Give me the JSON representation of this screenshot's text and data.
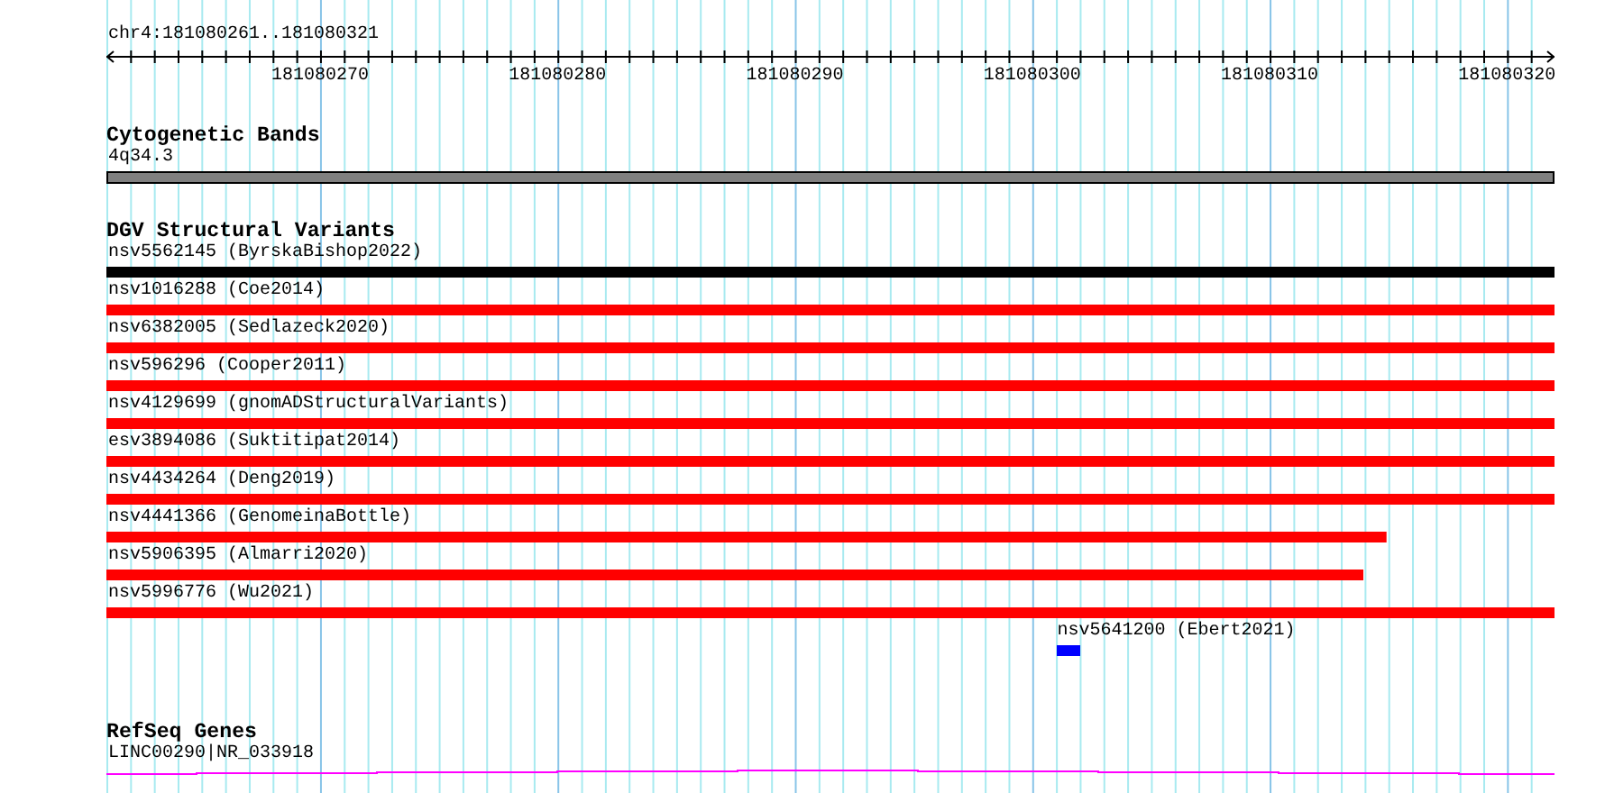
{
  "ruler": {
    "location": "chr4:181080261..181080321",
    "ticks": [
      "181080270",
      "181080280",
      "181080290",
      "181080300",
      "181080310",
      "181080320"
    ]
  },
  "cytogenetic_bands": {
    "title": "Cytogenetic Bands",
    "band": "4q34.3"
  },
  "dgv_structural_variants": {
    "title": "DGV Structural Variants",
    "variants": [
      {
        "label": "nsv5562145 (ByrskaBishop2022)",
        "kind": "full",
        "color": "#000000"
      },
      {
        "label": "nsv1016288 (Coe2014)",
        "kind": "full",
        "color": "#ff0000"
      },
      {
        "label": "nsv6382005 (Sedlazeck2020)",
        "kind": "full",
        "color": "#ff0000"
      },
      {
        "label": "nsv596296 (Cooper2011)",
        "kind": "full",
        "color": "#ff0000"
      },
      {
        "label": "nsv4129699 (gnomADStructuralVariants)",
        "kind": "full",
        "color": "#ff0000"
      },
      {
        "label": "esv3894086 (Suktitipat2014)",
        "kind": "full",
        "color": "#ff0000"
      },
      {
        "label": "nsv4434264 (Deng2019)",
        "kind": "full",
        "color": "#ff0000"
      },
      {
        "label": "nsv4441366 (GenomeinaBottle)",
        "kind": "partial",
        "level": 0.884,
        "color": "#ff0000"
      },
      {
        "label": "nsv5906395 (Almarri2020)",
        "kind": "partial",
        "level": 0.868,
        "color": "#ff0000"
      },
      {
        "label": "nsv5996776 (Wu2021)",
        "kind": "full",
        "color": "#ff0000"
      },
      {
        "label": "nsv5641200 (Ebert2021)",
        "kind": "point",
        "level": 0.673,
        "color": "#0000ff"
      }
    ]
  },
  "refseq_genes": {
    "title": "RefSeq Genes",
    "gene": "LINC00290|NR_033918"
  }
}
